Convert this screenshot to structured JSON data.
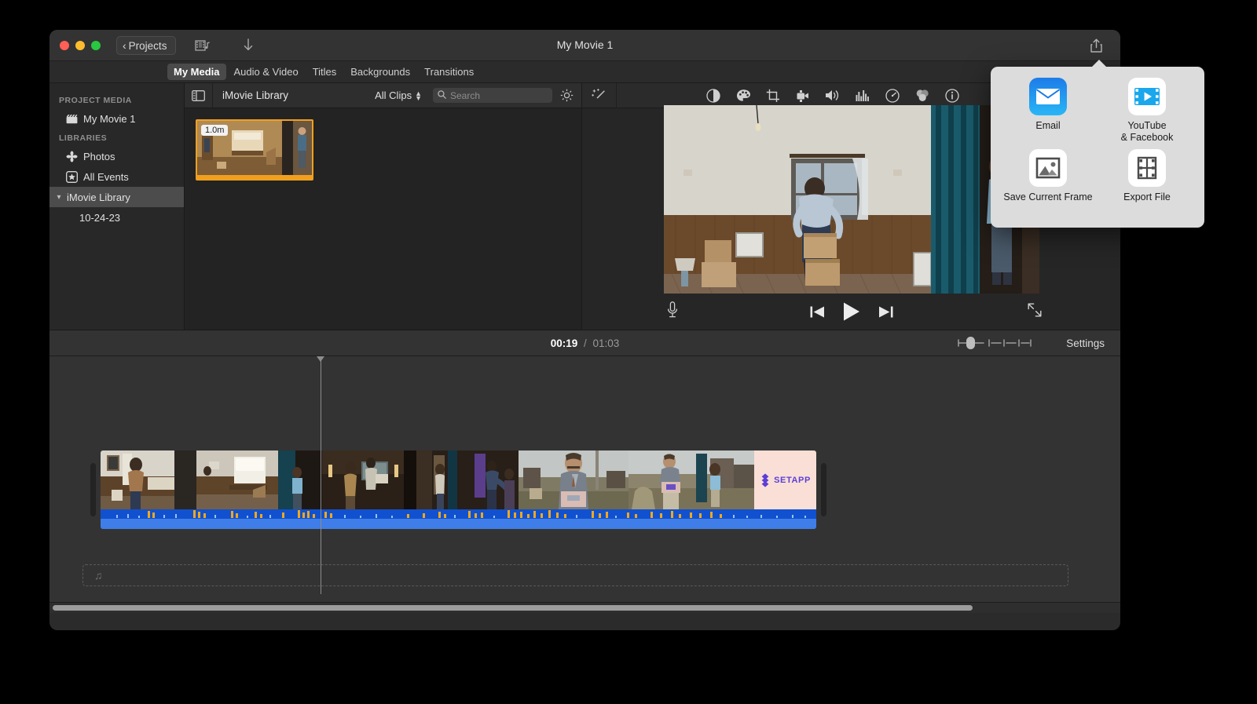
{
  "window": {
    "title": "My Movie 1",
    "back_button": "Projects",
    "traffic_lights": [
      "close",
      "minimize",
      "zoom"
    ],
    "toolbar_icons": [
      "film-audio-icon",
      "download-icon",
      "share-icon"
    ]
  },
  "tabs": [
    {
      "label": "My Media",
      "active": true
    },
    {
      "label": "Audio & Video",
      "active": false
    },
    {
      "label": "Titles",
      "active": false
    },
    {
      "label": "Backgrounds",
      "active": false
    },
    {
      "label": "Transitions",
      "active": false
    }
  ],
  "sidebar": {
    "sections": [
      {
        "header": "PROJECT MEDIA",
        "items": [
          {
            "label": "My Movie 1",
            "icon": "clapperboard-icon",
            "selected": false
          }
        ]
      },
      {
        "header": "LIBRARIES",
        "items": [
          {
            "label": "Photos",
            "icon": "photos-flower-icon",
            "selected": false
          },
          {
            "label": "All Events",
            "icon": "star-square-icon",
            "selected": false
          },
          {
            "label": "iMovie Library",
            "icon": "disclosure-icon",
            "selected": true
          },
          {
            "label": "10-24-23",
            "icon": "event-icon",
            "selected": false
          }
        ]
      }
    ]
  },
  "browser": {
    "sidebar_toggle_icon": "sidebar-toggle-icon",
    "title": "iMovie Library",
    "filter_label": "All Clips",
    "filter_chevron": "chevron-updown-icon",
    "search_placeholder": "Search",
    "search_value": "",
    "search_icon": "search-icon",
    "settings_icon": "gear-icon",
    "clips": [
      {
        "duration_badge": "1.0m",
        "selected": true
      }
    ]
  },
  "viewer": {
    "wand_icon": "magic-wand-icon",
    "adjust_icons": [
      "color-balance-icon",
      "color-correction-icon",
      "crop-icon",
      "stabilization-icon",
      "volume-icon",
      "equalizer-icon",
      "speed-icon",
      "filters-icon",
      "info-icon"
    ],
    "player": {
      "mic_icon": "microphone-icon",
      "skip_back_icon": "skip-to-start-icon",
      "play_icon": "play-icon",
      "skip_forward_icon": "skip-to-end-icon",
      "fullscreen_icon": "fullscreen-icon"
    }
  },
  "timeline_toolbar": {
    "current_time": "00:19",
    "separator": "/",
    "total_time": "01:03",
    "zoom_slider_icon": "zoom-slider",
    "zoom_value": 2,
    "zoom_ticks": 6,
    "settings_label": "Settings"
  },
  "timeline": {
    "clip": {
      "end_card_text": "SETAPP",
      "end_card_bg": "#f9dfd6",
      "end_card_fg": "#5b3fd6",
      "audio_color": "#1151cf"
    },
    "music_dropzone_icon": "music-note-icon",
    "playhead_position": "00:19"
  },
  "share_popover": {
    "items": [
      {
        "label": "Email",
        "icon": "email-icon"
      },
      {
        "label": "YouTube\n& Facebook",
        "label_line1": "YouTube",
        "label_line2": "& Facebook",
        "icon": "youtube-facebook-icon"
      },
      {
        "label": "Save Current Frame",
        "icon": "save-frame-icon"
      },
      {
        "label": "Export File",
        "icon": "export-file-icon"
      }
    ]
  },
  "colors": {
    "accent_orange": "#f0a01e",
    "audio_blue": "#1151cf",
    "window_bg": "#2b2b2b",
    "titlebar_bg": "#333333",
    "popover_bg": "#dcdcdc"
  }
}
